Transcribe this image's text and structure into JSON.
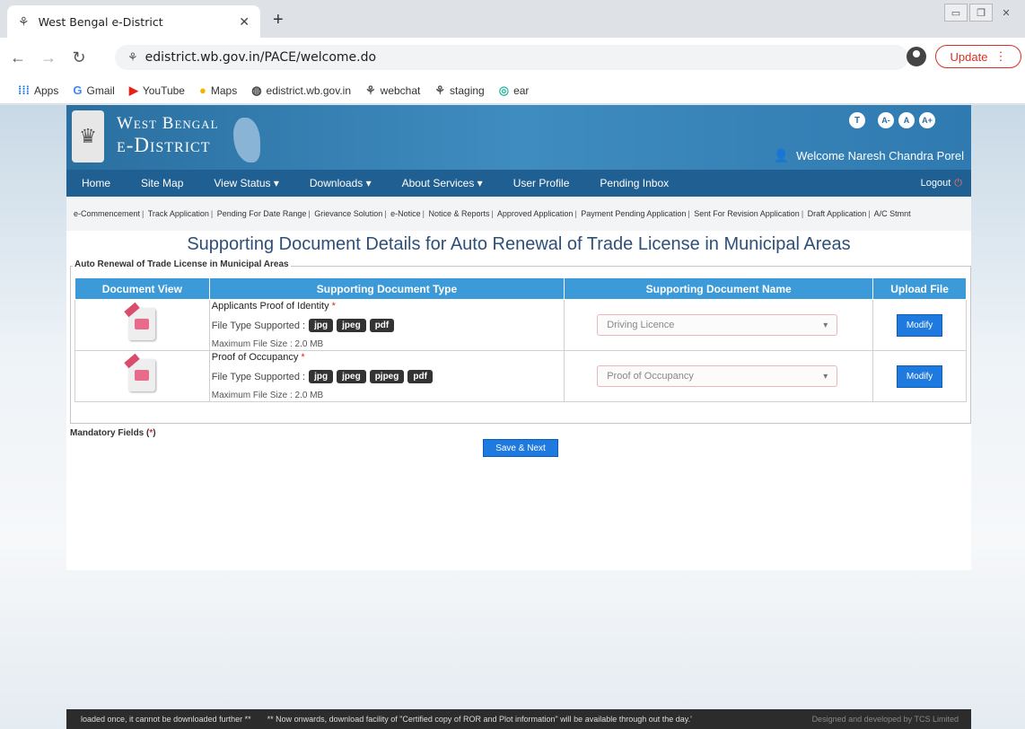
{
  "browser": {
    "tab_title": "West Bengal e-District",
    "url": "edistrict.wb.gov.in/PACE/welcome.do",
    "update_label": "Update",
    "bookmarks": [
      "Apps",
      "Gmail",
      "YouTube",
      "Maps",
      "edistrict.wb.gov.in",
      "webchat",
      "staging",
      "ear"
    ]
  },
  "header": {
    "brand_line1": "West Bengal",
    "brand_line2": "e-District",
    "tool_t": "T",
    "font_small": "A-",
    "font_normal": "A",
    "font_large": "A+",
    "welcome": "Welcome Naresh Chandra Porel"
  },
  "nav": {
    "items": [
      "Home",
      "Site Map",
      "View Status ▾",
      "Downloads ▾",
      "About Services ▾",
      "User Profile",
      "Pending Inbox"
    ],
    "logout": "Logout"
  },
  "quicklinks": [
    "e-Commencement",
    "Track Application",
    "Pending For Date Range",
    "Grievance Solution",
    "e-Notice",
    "Notice & Reports",
    "Approved Application",
    "Payment Pending Application",
    "Sent For Revision Application",
    "Draft Application",
    "A/C Stmnt"
  ],
  "page": {
    "title": "Supporting Document Details for Auto Renewal of Trade License in Municipal Areas",
    "legend": "Auto Renewal of Trade License in Municipal Areas",
    "columns": [
      "Document View",
      "Supporting Document Type",
      "Supporting Document Name",
      "Upload File"
    ],
    "file_type_label": "File Type Supported :",
    "rows": [
      {
        "name": "Applicants Proof of Identity",
        "req": "*",
        "types": [
          "jpg",
          "jpeg",
          "pdf"
        ],
        "max": "Maximum File Size : 2.0 MB",
        "selected": "Driving Licence",
        "action": "Modify"
      },
      {
        "name": "Proof of Occupancy",
        "req": "*",
        "types": [
          "jpg",
          "jpeg",
          "pjpeg",
          "pdf"
        ],
        "max": "Maximum File Size : 2.0 MB",
        "selected": "Proof of Occupancy",
        "action": "Modify"
      }
    ],
    "mandatory_prefix": "Mandatory Fields (",
    "mandatory_star": "*",
    "mandatory_suffix": ")",
    "save_label": "Save & Next"
  },
  "footer": {
    "ticker1": "loaded once, it cannot be downloaded further **",
    "ticker2": "** Now onwards, download facility of \"Certified copy of ROR and Plot information\" will be available through out the day.'",
    "credit": "Designed and developed by TCS Limited"
  }
}
